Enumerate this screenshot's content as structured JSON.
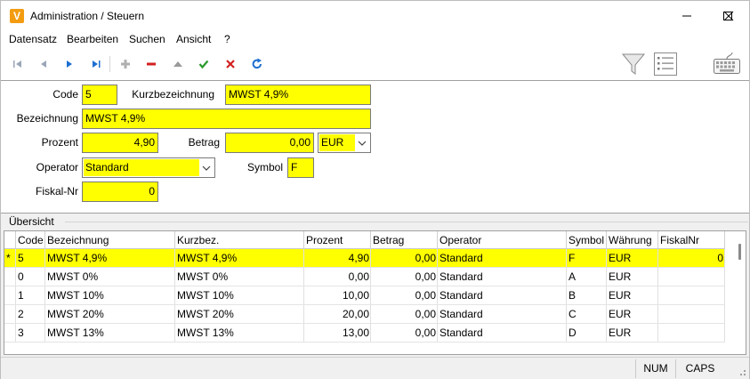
{
  "window": {
    "title": "Administration / Steuern",
    "app_icon_letter": "V"
  },
  "menu": [
    "Datensatz",
    "Bearbeiten",
    "Suchen",
    "Ansicht",
    "?"
  ],
  "form": {
    "code_label": "Code",
    "code_value": "5",
    "kurzbez_label": "Kurzbezeichnung",
    "kurzbez_value": "MWST 4,9%",
    "bezeichnung_label": "Bezeichnung",
    "bezeichnung_value": "MWST 4,9%",
    "prozent_label": "Prozent",
    "prozent_value": "4,90",
    "betrag_label": "Betrag",
    "betrag_value": "0,00",
    "waehrung_value": "EUR",
    "operator_label": "Operator",
    "operator_value": "Standard",
    "symbol_label": "Symbol",
    "symbol_value": "F",
    "fiskal_label": "Fiskal-Nr",
    "fiskal_value": "0"
  },
  "overview": {
    "label": "Übersicht",
    "columns": [
      "Code",
      "Bezeichnung",
      "Kurzbez.",
      "Prozent",
      "Betrag",
      "Operator",
      "Symbol",
      "Währung",
      "FiskalNr"
    ],
    "rows": [
      {
        "indicator": "*",
        "code": "5",
        "bez": "MWST 4,9%",
        "kurz": "MWST 4,9%",
        "prozent": "4,90",
        "betrag": "0,00",
        "operator": "Standard",
        "symbol": "F",
        "waehrung": "EUR",
        "fiskal": "0"
      },
      {
        "indicator": "",
        "code": "0",
        "bez": "MWST 0%",
        "kurz": "MWST 0%",
        "prozent": "0,00",
        "betrag": "0,00",
        "operator": "Standard",
        "symbol": "A",
        "waehrung": "EUR",
        "fiskal": ""
      },
      {
        "indicator": "",
        "code": "1",
        "bez": "MWST 10%",
        "kurz": "MWST 10%",
        "prozent": "10,00",
        "betrag": "0,00",
        "operator": "Standard",
        "symbol": "B",
        "waehrung": "EUR",
        "fiskal": ""
      },
      {
        "indicator": "",
        "code": "2",
        "bez": "MWST 20%",
        "kurz": "MWST 20%",
        "prozent": "20,00",
        "betrag": "0,00",
        "operator": "Standard",
        "symbol": "C",
        "waehrung": "EUR",
        "fiskal": ""
      },
      {
        "indicator": "",
        "code": "3",
        "bez": "MWST 13%",
        "kurz": "MWST 13%",
        "prozent": "13,00",
        "betrag": "0,00",
        "operator": "Standard",
        "symbol": "D",
        "waehrung": "EUR",
        "fiskal": ""
      }
    ]
  },
  "status": {
    "num": "NUM",
    "caps": "CAPS"
  },
  "colors": {
    "field_highlight": "#ffff00",
    "app_icon": "#f39c12",
    "nav_blue": "#1e6fd0",
    "delete_red": "#d22020",
    "ok_green": "#2a9a2a"
  }
}
